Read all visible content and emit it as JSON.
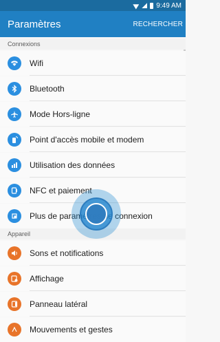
{
  "status_bar": {
    "time": "9:49 AM",
    "icons": [
      "wifi-icon",
      "signal-icon",
      "battery-icon"
    ]
  },
  "header": {
    "title": "Paramètres",
    "search_label": "RECHERCHER"
  },
  "sections": [
    {
      "title": "Connexions",
      "items": [
        {
          "label": "Wifi",
          "icon": "wifi-icon",
          "color": "#2b8fe0"
        },
        {
          "label": "Bluetooth",
          "icon": "bluetooth-icon",
          "color": "#2b8fe0"
        },
        {
          "label": "Mode Hors-ligne",
          "icon": "airplane-icon",
          "color": "#2b8fe0"
        },
        {
          "label": "Point d'accès mobile et modem",
          "icon": "hotspot-icon",
          "color": "#2b8fe0"
        },
        {
          "label": "Utilisation des données",
          "icon": "data-usage-icon",
          "color": "#2b8fe0"
        },
        {
          "label": "NFC et paiement",
          "icon": "nfc-icon",
          "color": "#2b8fe0"
        },
        {
          "label": "Plus de paramètres de connexion",
          "icon": "more-connections-icon",
          "color": "#2b8fe0"
        }
      ]
    },
    {
      "title": "Appareil",
      "items": [
        {
          "label": "Sons et notifications",
          "icon": "sound-icon",
          "color": "#e8742a"
        },
        {
          "label": "Affichage",
          "icon": "display-icon",
          "color": "#e8742a"
        },
        {
          "label": "Panneau latéral",
          "icon": "edge-panel-icon",
          "color": "#e8742a"
        },
        {
          "label": "Mouvements et gestes",
          "icon": "motion-icon",
          "color": "#e8742a"
        }
      ]
    }
  ]
}
